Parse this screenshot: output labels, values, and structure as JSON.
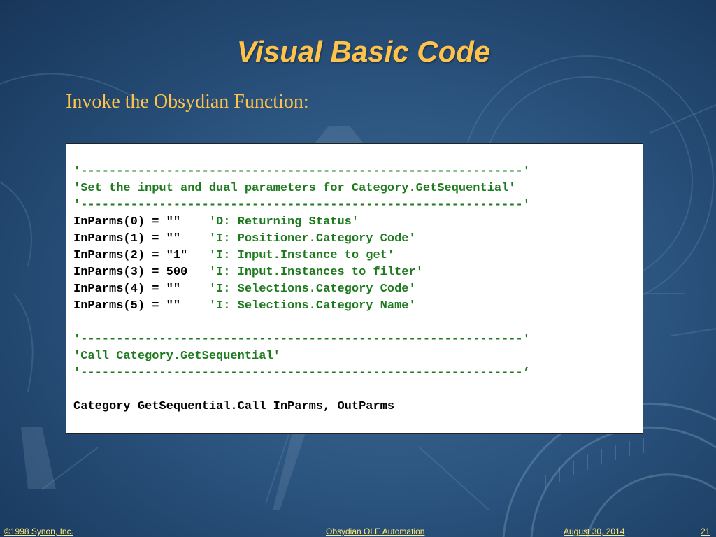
{
  "slide": {
    "title": "Visual Basic Code",
    "subtitle": "Invoke the Obsydian Function:"
  },
  "code": {
    "lines": [
      {
        "code": "",
        "comment": "'--------------------------------------------------------------'"
      },
      {
        "code": "",
        "comment": "'Set the input and dual parameters for Category.GetSequential'"
      },
      {
        "code": "",
        "comment": "'--------------------------------------------------------------'"
      },
      {
        "code": "InParms(0) = \"\"    ",
        "comment": "'D: Returning Status'"
      },
      {
        "code": "InParms(1) = \"\"    ",
        "comment": "'I: Positioner.Category Code'"
      },
      {
        "code": "InParms(2) = \"1\"   ",
        "comment": "'I: Input.Instance to get'"
      },
      {
        "code": "InParms(3) = 500   ",
        "comment": "'I: Input.Instances to filter'"
      },
      {
        "code": "InParms(4) = \"\"    ",
        "comment": "'I: Selections.Category Code'"
      },
      {
        "code": "InParms(5) = \"\"    ",
        "comment": "'I: Selections.Category Name'"
      },
      {
        "code": "",
        "comment": ""
      },
      {
        "code": "",
        "comment": "'--------------------------------------------------------------'"
      },
      {
        "code": "",
        "comment": "'Call Category.GetSequential'"
      },
      {
        "code": "",
        "comment": "'--------------------------------------------------------------’"
      },
      {
        "code": "",
        "comment": ""
      },
      {
        "code": "Category_GetSequential.Call InParms, OutParms",
        "comment": ""
      }
    ]
  },
  "footer": {
    "copyright": "©1998 Synon, Inc.",
    "presentation": "Obsydian OLE Automation",
    "date": "August 30, 2014",
    "page": "21"
  },
  "colors": {
    "title": "#ffc24a",
    "comment": "#1e7a1e",
    "footer": "#ffe97a"
  }
}
